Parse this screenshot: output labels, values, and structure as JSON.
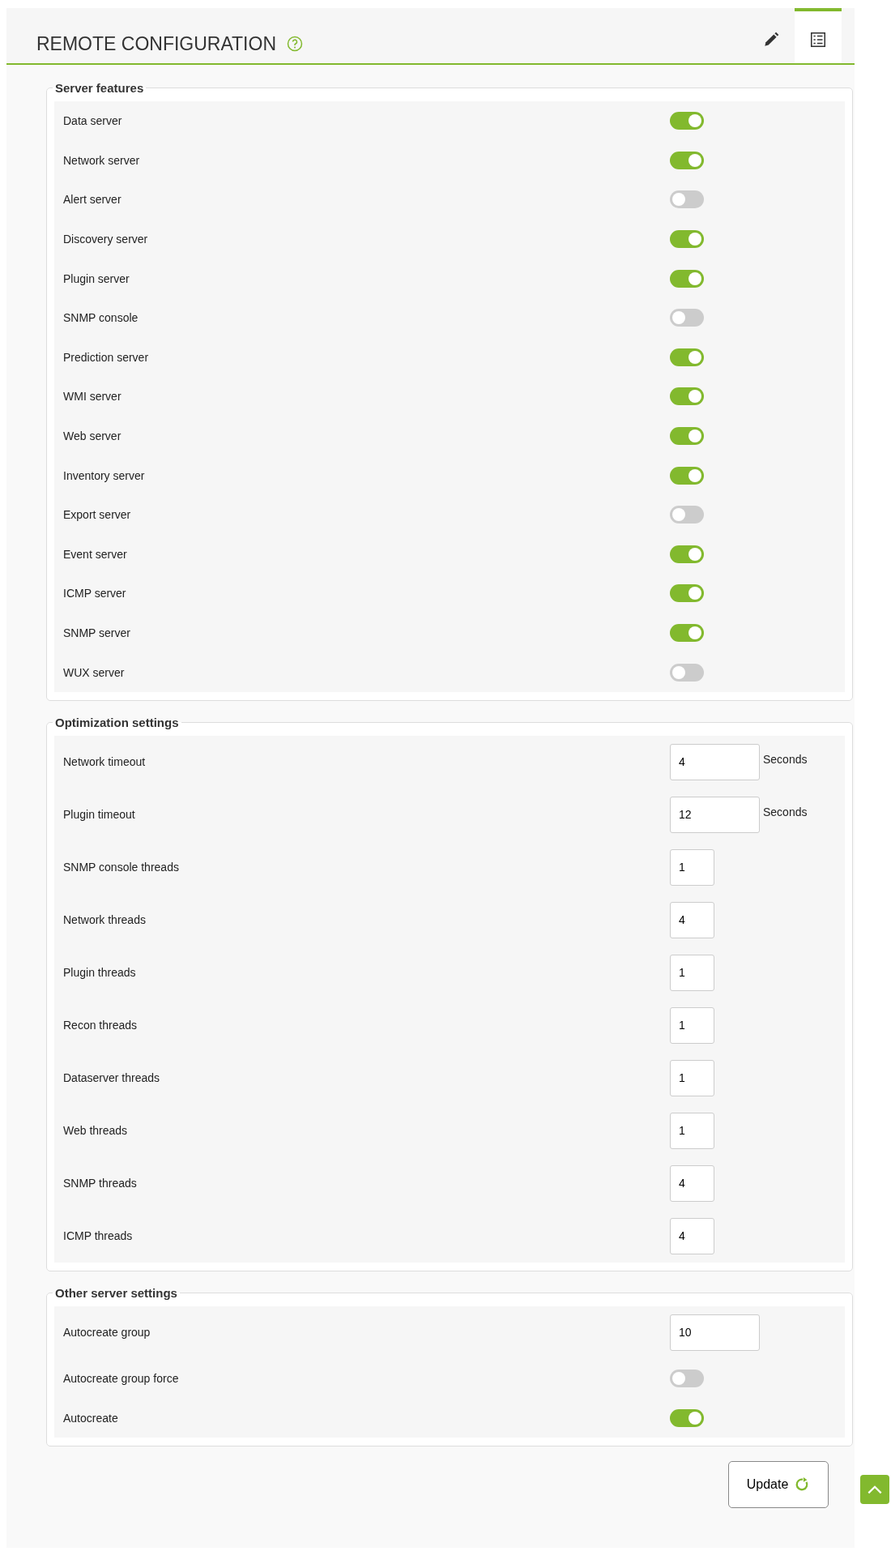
{
  "header": {
    "title": "REMOTE CONFIGURATION",
    "tabs": [
      {
        "kind": "edit",
        "selected": false
      },
      {
        "kind": "list",
        "selected": true
      }
    ]
  },
  "sections": [
    {
      "legend": "Server features",
      "rows": [
        {
          "kind": "toggle",
          "label": "Data server",
          "on": true
        },
        {
          "kind": "toggle",
          "label": "Network server",
          "on": true
        },
        {
          "kind": "toggle",
          "label": "Alert server",
          "on": false
        },
        {
          "kind": "toggle",
          "label": "Discovery server",
          "on": true
        },
        {
          "kind": "toggle",
          "label": "Plugin server",
          "on": true
        },
        {
          "kind": "toggle",
          "label": "SNMP console",
          "on": false
        },
        {
          "kind": "toggle",
          "label": "Prediction server",
          "on": true
        },
        {
          "kind": "toggle",
          "label": "WMI server",
          "on": true
        },
        {
          "kind": "toggle",
          "label": "Web server",
          "on": true
        },
        {
          "kind": "toggle",
          "label": "Inventory server",
          "on": true
        },
        {
          "kind": "toggle",
          "label": "Export server",
          "on": false
        },
        {
          "kind": "toggle",
          "label": "Event server",
          "on": true
        },
        {
          "kind": "toggle",
          "label": "ICMP server",
          "on": true
        },
        {
          "kind": "toggle",
          "label": "SNMP server",
          "on": true
        },
        {
          "kind": "toggle",
          "label": "WUX server",
          "on": false
        }
      ]
    },
    {
      "legend": "Optimization settings",
      "rows": [
        {
          "kind": "wide",
          "label": "Network timeout",
          "value": "4",
          "unit": "Seconds"
        },
        {
          "kind": "wide",
          "label": "Plugin timeout",
          "value": "12",
          "unit": "Seconds"
        },
        {
          "kind": "short",
          "label": "SNMP console threads",
          "value": "1"
        },
        {
          "kind": "short",
          "label": "Network threads",
          "value": "4"
        },
        {
          "kind": "short",
          "label": "Plugin threads",
          "value": "1"
        },
        {
          "kind": "short",
          "label": "Recon threads",
          "value": "1"
        },
        {
          "kind": "short",
          "label": "Dataserver threads",
          "value": "1"
        },
        {
          "kind": "short",
          "label": "Web threads",
          "value": "1"
        },
        {
          "kind": "short",
          "label": "SNMP threads",
          "value": "4"
        },
        {
          "kind": "short",
          "label": "ICMP threads",
          "value": "4"
        }
      ]
    },
    {
      "legend": "Other server settings",
      "rows": [
        {
          "kind": "wide",
          "label": "Autocreate group",
          "value": "10"
        },
        {
          "kind": "toggle",
          "label": "Autocreate group force",
          "on": false
        },
        {
          "kind": "toggle",
          "label": "Autocreate",
          "on": true
        }
      ]
    }
  ],
  "update_button": "Update"
}
